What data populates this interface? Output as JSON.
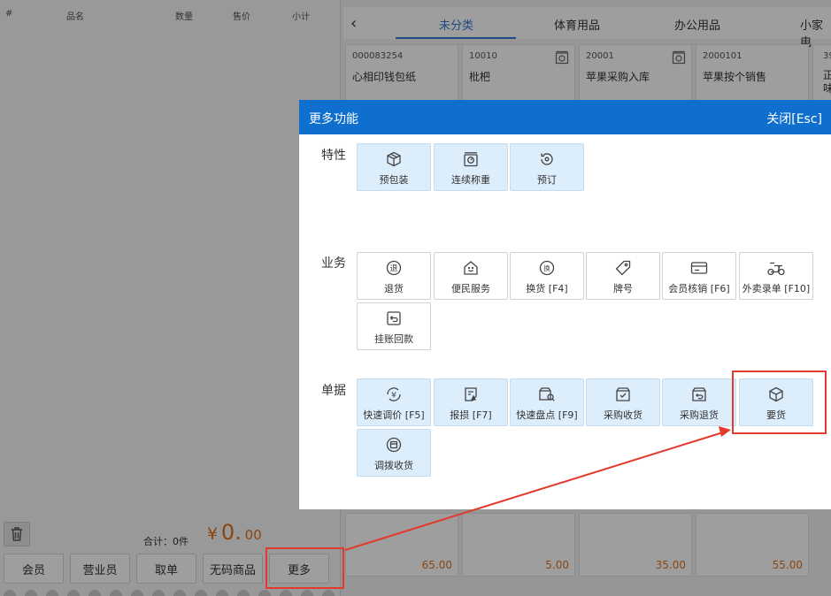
{
  "cart": {
    "columns": [
      "#",
      "品名",
      "数量",
      "售价",
      "小计"
    ],
    "total_label": "合计：0件",
    "total_currency": "¥",
    "total_integer": "0.",
    "total_decimal": "00"
  },
  "bottom_buttons": {
    "member": "会员",
    "salesperson": "营业员",
    "take_order": "取单",
    "no_code": "无码商品",
    "more": "更多"
  },
  "tabs": {
    "back": "‹",
    "items": [
      "未分类",
      "体育用品",
      "办公用品",
      "小家电"
    ]
  },
  "products": [
    {
      "code": "000083254",
      "name": "心相印钱包纸"
    },
    {
      "code": "10010",
      "name": "枇杷"
    },
    {
      "code": "20001",
      "name": "苹果采购入库"
    },
    {
      "code": "2000101",
      "name": "苹果按个销售"
    },
    {
      "code": "39",
      "name": "正味"
    }
  ],
  "prices": [
    "65.00",
    "5.00",
    "35.00",
    "55.00"
  ],
  "modal": {
    "title": "更多功能",
    "close": "关闭[Esc]",
    "sections": {
      "features": "特性",
      "business": "业务",
      "documents": "单据"
    },
    "features": [
      "预包装",
      "连续称重",
      "预订"
    ],
    "business": [
      "退货",
      "便民服务",
      "换货 [F4]",
      "牌号",
      "会员核销 [F6]",
      "外卖录单 [F10]",
      "挂账回款"
    ],
    "documents": [
      "快速调价 [F5]",
      "报损 [F7]",
      "快速盘点 [F9]",
      "采购收货",
      "采购退货",
      "要货",
      "调拨收货"
    ]
  },
  "icons": {
    "prepack": "box-icon",
    "weigh": "scale-icon",
    "reserve": "reservation-icon",
    "return": "return-icon",
    "service": "home-service-icon",
    "exchange": "exchange-icon",
    "tag": "tag-icon",
    "member_verify": "card-icon",
    "delivery": "scooter-icon",
    "credit": "credit-return-icon",
    "price_adjust": "yen-cycle-icon",
    "loss": "report-loss-icon",
    "inventory": "inventory-search-icon",
    "purchase_receive": "receive-icon",
    "purchase_return": "purchase-return-icon",
    "request": "cube-icon",
    "transfer": "transfer-icon"
  },
  "colors": {
    "accent": "#0f6fce",
    "highlight": "#e23a2e",
    "price": "#e0721b"
  }
}
